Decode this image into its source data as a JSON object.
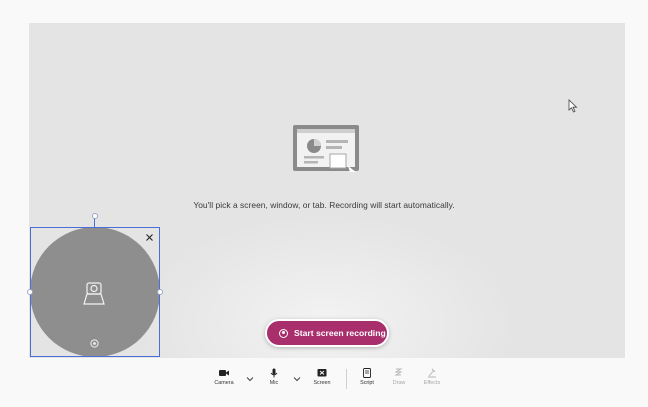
{
  "prompt": {
    "message": "You'll pick a screen, window, or tab. Recording will start automatically."
  },
  "record_button": {
    "label": "Start screen recording",
    "color": "#a82e6c"
  },
  "toolbar": {
    "items": [
      {
        "label": "Camera",
        "icon": "camera-icon",
        "enabled": true
      },
      {
        "label": "Mic",
        "icon": "mic-icon",
        "enabled": true
      },
      {
        "label": "Screen",
        "icon": "screen-icon",
        "enabled": true
      },
      {
        "label": "Script",
        "icon": "script-icon",
        "enabled": true
      },
      {
        "label": "Draw",
        "icon": "draw-icon",
        "enabled": false
      },
      {
        "label": "Effects",
        "icon": "effects-icon",
        "enabled": false
      }
    ]
  },
  "colors": {
    "stage": "#e4e4e4",
    "camera_preview": "#8e8e8e",
    "selection": "#4b6fd6"
  }
}
